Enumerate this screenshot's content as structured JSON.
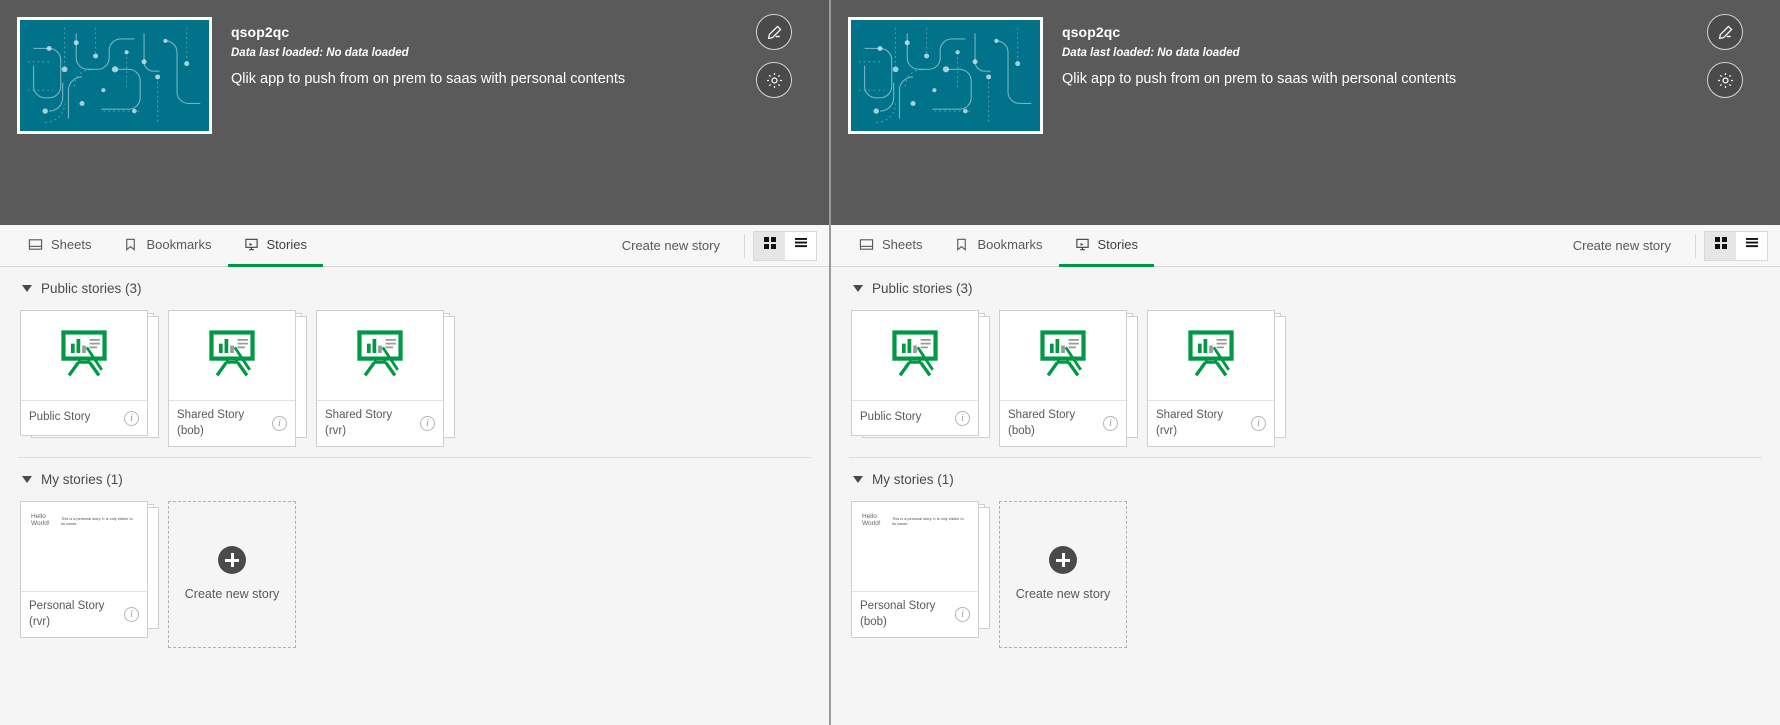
{
  "colors": {
    "header_bg": "#5a5a5a",
    "thumb_bg": "#00738a",
    "accent_green": "#009845",
    "page_bg": "#f5f5f5"
  },
  "panels": [
    {
      "header": {
        "title": "qsop2qc",
        "subtitle": "Data last loaded: No data loaded",
        "description": "Qlik app to push from on prem to saas with personal contents",
        "edit_label": "Edit",
        "settings_label": "App options"
      },
      "tabbar": {
        "tabs": [
          {
            "label": "Sheets",
            "icon": "sheet-icon",
            "active": false
          },
          {
            "label": "Bookmarks",
            "icon": "bookmark-icon",
            "active": false
          },
          {
            "label": "Stories",
            "icon": "story-icon",
            "active": true
          }
        ],
        "create_label": "Create new story",
        "grid_view_label": "Grid view",
        "list_view_label": "List view",
        "active_view": "grid"
      },
      "sections": [
        {
          "title": "Public stories (3)",
          "cards": [
            {
              "name": "Public Story",
              "thumb": "story-easel"
            },
            {
              "name": "Shared Story (bob)",
              "thumb": "story-easel"
            },
            {
              "name": "Shared Story (rvr)",
              "thumb": "story-easel"
            }
          ],
          "show_create": false
        },
        {
          "title": "My stories (1)",
          "cards": [
            {
              "name": "Personal Story (rvr)",
              "thumb": "text-slide",
              "thumb_title": "Hello World!",
              "thumb_body": "This is a personal story. It is only visible to its owner."
            }
          ],
          "show_create": true,
          "create_label": "Create new story"
        }
      ]
    },
    {
      "header": {
        "title": "qsop2qc",
        "subtitle": "Data last loaded: No data loaded",
        "description": "Qlik app to push from on prem to saas with personal contents",
        "edit_label": "Edit",
        "settings_label": "App options"
      },
      "tabbar": {
        "tabs": [
          {
            "label": "Sheets",
            "icon": "sheet-icon",
            "active": false
          },
          {
            "label": "Bookmarks",
            "icon": "bookmark-icon",
            "active": false
          },
          {
            "label": "Stories",
            "icon": "story-icon",
            "active": true
          }
        ],
        "create_label": "Create new story",
        "grid_view_label": "Grid view",
        "list_view_label": "List view",
        "active_view": "grid"
      },
      "sections": [
        {
          "title": "Public stories (3)",
          "cards": [
            {
              "name": "Public Story",
              "thumb": "story-easel"
            },
            {
              "name": "Shared Story (bob)",
              "thumb": "story-easel"
            },
            {
              "name": "Shared Story (rvr)",
              "thumb": "story-easel"
            }
          ],
          "show_create": false
        },
        {
          "title": "My stories (1)",
          "cards": [
            {
              "name": "Personal Story (bob)",
              "thumb": "text-slide",
              "thumb_title": "Hello World!",
              "thumb_body": "This is a personal story. It is only visible to its owner."
            }
          ],
          "show_create": true,
          "create_label": "Create new story"
        }
      ]
    }
  ]
}
